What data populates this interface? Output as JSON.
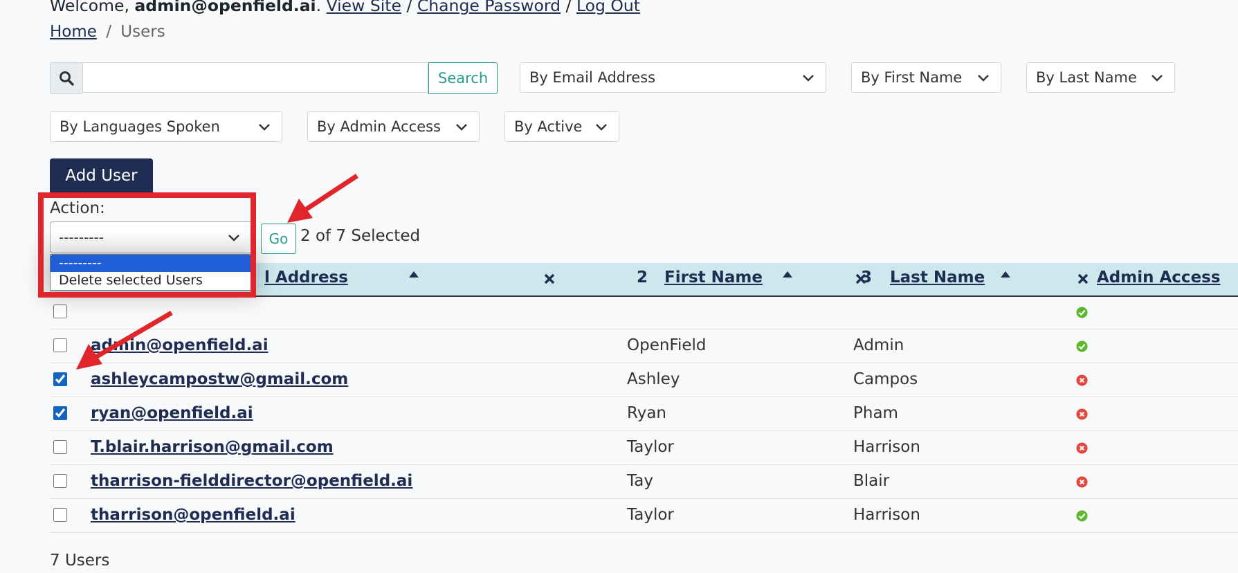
{
  "header": {
    "welcome_prefix": "Welcome,",
    "username": "admin@openfield.ai",
    "period": ".",
    "view_site": "View Site",
    "sep1": "/",
    "change_password": "Change Password",
    "sep2": "/",
    "log_out": "Log Out"
  },
  "breadcrumb": {
    "home": "Home",
    "sep": "/",
    "current": "Users"
  },
  "search": {
    "value": "",
    "button": "Search"
  },
  "filters": {
    "email": "By Email Address",
    "first_name": "By First Name",
    "last_name": "By Last Name",
    "languages": "By Languages Spoken",
    "admin_access": "By Admin Access",
    "active": "By Active"
  },
  "add_user": "Add User",
  "action": {
    "label": "Action:",
    "selected": "---------",
    "options": [
      "---------",
      "Delete selected Users"
    ],
    "go": "Go",
    "counter": "2 of 7 Selected"
  },
  "table": {
    "columns": {
      "email": "l Address",
      "first_name_order": "2",
      "first_name": "First Name",
      "last_name_order": "3",
      "last_name": "Last Name",
      "admin_access": "Admin Access"
    },
    "rows": [
      {
        "email": "",
        "first": "",
        "last": "",
        "admin": true,
        "checked": false
      },
      {
        "email": "admin@openfield.ai",
        "first": "OpenField",
        "last": "Admin",
        "admin": true,
        "checked": false
      },
      {
        "email": "ashleycampostw@gmail.com",
        "first": "Ashley",
        "last": "Campos",
        "admin": false,
        "checked": true
      },
      {
        "email": "ryan@openfield.ai",
        "first": "Ryan",
        "last": "Pham",
        "admin": false,
        "checked": true
      },
      {
        "email": "T.blair.harrison@gmail.com",
        "first": "Taylor",
        "last": "Harrison",
        "admin": false,
        "checked": false
      },
      {
        "email": "tharrison-fielddirector@openfield.ai",
        "first": "Tay",
        "last": "Blair",
        "admin": false,
        "checked": false
      },
      {
        "email": "tharrison@openfield.ai",
        "first": "Taylor",
        "last": "Harrison",
        "admin": true,
        "checked": false
      }
    ]
  },
  "footer": {
    "count": "7 Users"
  },
  "icons": {
    "yes": "check-circle-icon",
    "no": "x-circle-icon",
    "colors": {
      "yes": "#5cb82a",
      "no": "#e2453c",
      "annotation": "#e0262b",
      "primary": "#1f2d52",
      "accent": "#2a9d8f"
    }
  }
}
